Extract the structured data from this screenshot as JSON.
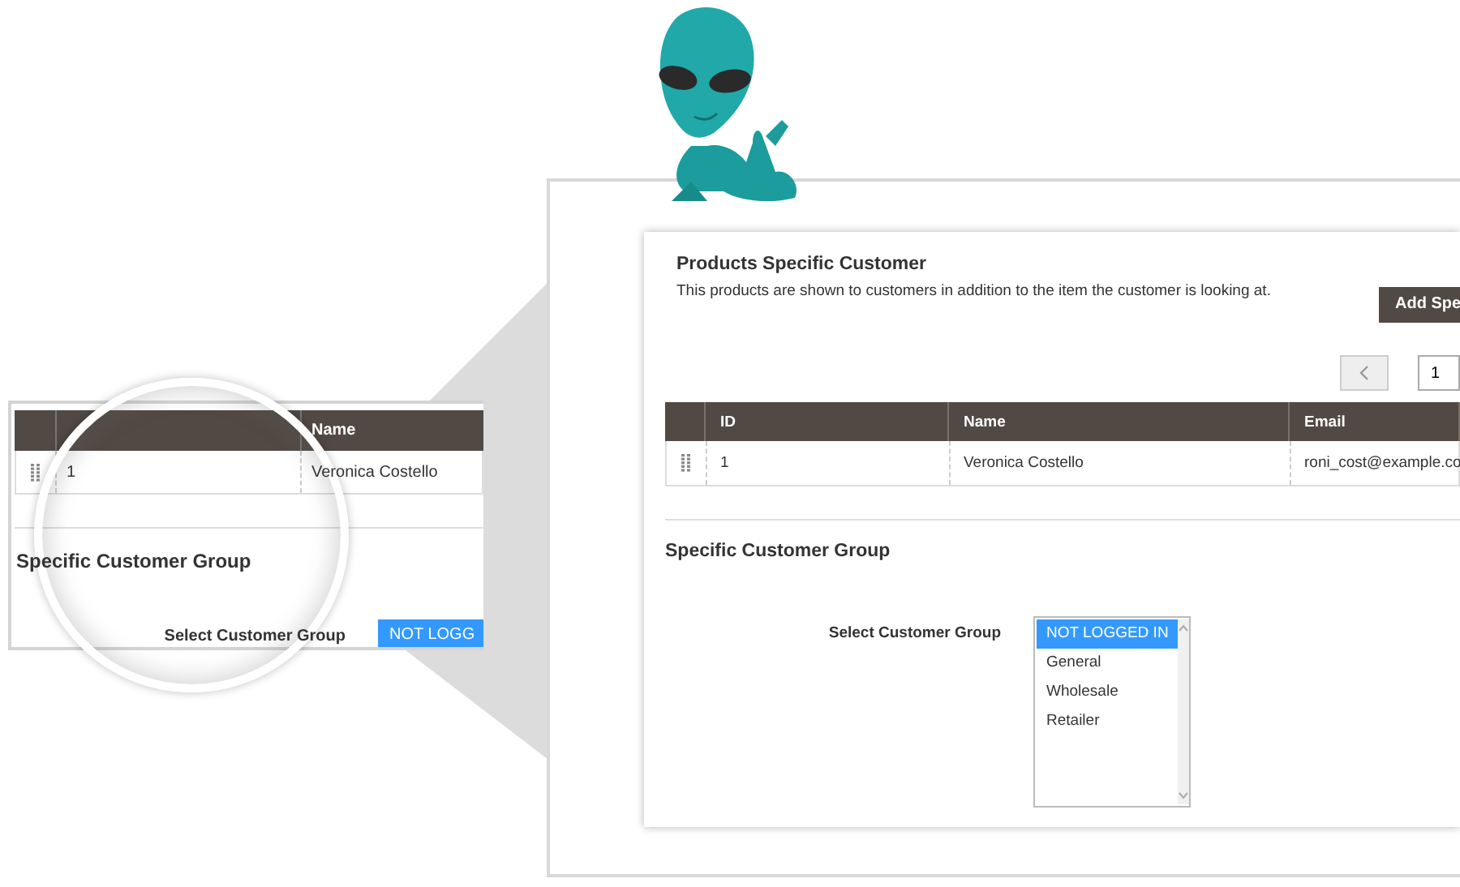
{
  "preview": {
    "table": {
      "columns": [
        "Name"
      ],
      "rows": [
        {
          "id": "1",
          "name": "Veronica Costello"
        }
      ]
    },
    "section_title": "Specific Customer Group",
    "group_label": "Select Customer Group",
    "group_value": "NOT LOGG"
  },
  "panel": {
    "title": "Products Specific Customer",
    "description": "This products are shown to customers in addition to the item the customer is looking at.",
    "add_button": "Add Spe",
    "page": "1",
    "table": {
      "columns": [
        "ID",
        "Name",
        "Email"
      ],
      "rows": [
        {
          "id": "1",
          "name": "Veronica Costello",
          "email": "roni_cost@example.co"
        }
      ]
    },
    "section_title": "Specific Customer Group",
    "group_label": "Select Customer Group",
    "options": [
      {
        "label": "NOT LOGGED IN",
        "selected": true
      },
      {
        "label": "General",
        "selected": false
      },
      {
        "label": "Wholesale",
        "selected": false
      },
      {
        "label": "Retailer",
        "selected": false
      }
    ]
  }
}
